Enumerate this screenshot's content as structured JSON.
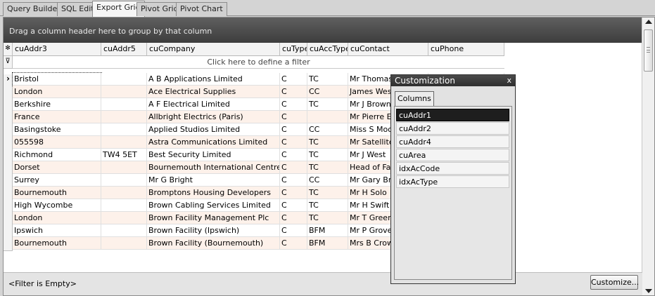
{
  "tabs": [
    "Query Builder",
    "SQL Edit",
    "Export Grid",
    "Pivot Grid",
    "Pivot Chart"
  ],
  "active_tab": "Export Grid",
  "group_panel_text": "Drag a column header here to group by that column",
  "columns": [
    "cuAddr3",
    "cuAddr5",
    "cuCompany",
    "cuType",
    "cuAccType",
    "cuContact",
    "cuPhone"
  ],
  "filter_row_text": "Click here to define a filter",
  "rows": [
    [
      "Bristol",
      "",
      "A B Applications Limited",
      "C",
      "TC",
      "Mr Thomas",
      ""
    ],
    [
      "London",
      "",
      "Ace Electrical Supplies",
      "C",
      "CC",
      "James West",
      ""
    ],
    [
      "Berkshire",
      "",
      "A F Electrical Limited",
      "C",
      "TC",
      "Mr J Brown",
      ""
    ],
    [
      "France",
      "",
      "Allbright Electrics (Paris)",
      "C",
      "",
      "Mr Pierre Et",
      ""
    ],
    [
      "Basingstoke",
      "",
      "Applied Studios Limited",
      "C",
      "CC",
      "Miss S Moor",
      ""
    ],
    [
      "055598",
      "",
      "Astra Communications Limited",
      "C",
      "TC",
      "Mr Satellite",
      ""
    ],
    [
      "Richmond",
      "TW4 5ET",
      "Best Security Limited",
      "C",
      "TC",
      "Mr J  West",
      ""
    ],
    [
      "Dorset",
      "",
      "Bournemouth International Centre Ltd",
      "C",
      "TC",
      "Head of Fac",
      ""
    ],
    [
      "Surrey",
      "",
      "Mr G Bright",
      "C",
      "CC",
      "Mr Gary Brig",
      ""
    ],
    [
      "Bournemouth",
      "",
      "Bromptons Housing Developers",
      "C",
      "TC",
      "Mr H Solo",
      ""
    ],
    [
      "High Wycombe",
      "",
      "Brown Cabling Services Limited",
      "C",
      "TC",
      "Mr H Swift",
      ""
    ],
    [
      "London",
      "",
      "Brown Facility Management Plc",
      "C",
      "TC",
      "Mr T Green",
      ""
    ],
    [
      "Ipswich",
      "",
      "Brown Facility (Ipswich)",
      "C",
      "BFM",
      "Mr P Grove",
      ""
    ],
    [
      "Bournemouth",
      "",
      "Brown Facility (Bournemouth)",
      "C",
      "BFM",
      "Mrs B Crow",
      ""
    ]
  ],
  "status": {
    "filter_text": "<Filter is Empty>",
    "customize_label": "Customize..."
  },
  "customization": {
    "title": "Customization",
    "close_glyph": "x",
    "tab_label": "Columns",
    "items": [
      "cuAddr1",
      "cuAddr2",
      "cuAddr4",
      "cuArea",
      "idxAcCode",
      "idxAcType"
    ],
    "selected": "cuAddr1"
  },
  "indicator_glyphs": {
    "new_row": "✻",
    "filter_row": "⊽",
    "current_row": "›"
  },
  "colors": {
    "group_panel": "#4a4a4a",
    "alt_row": "#fdf1ea",
    "selected_item": "#1e1e1e"
  }
}
